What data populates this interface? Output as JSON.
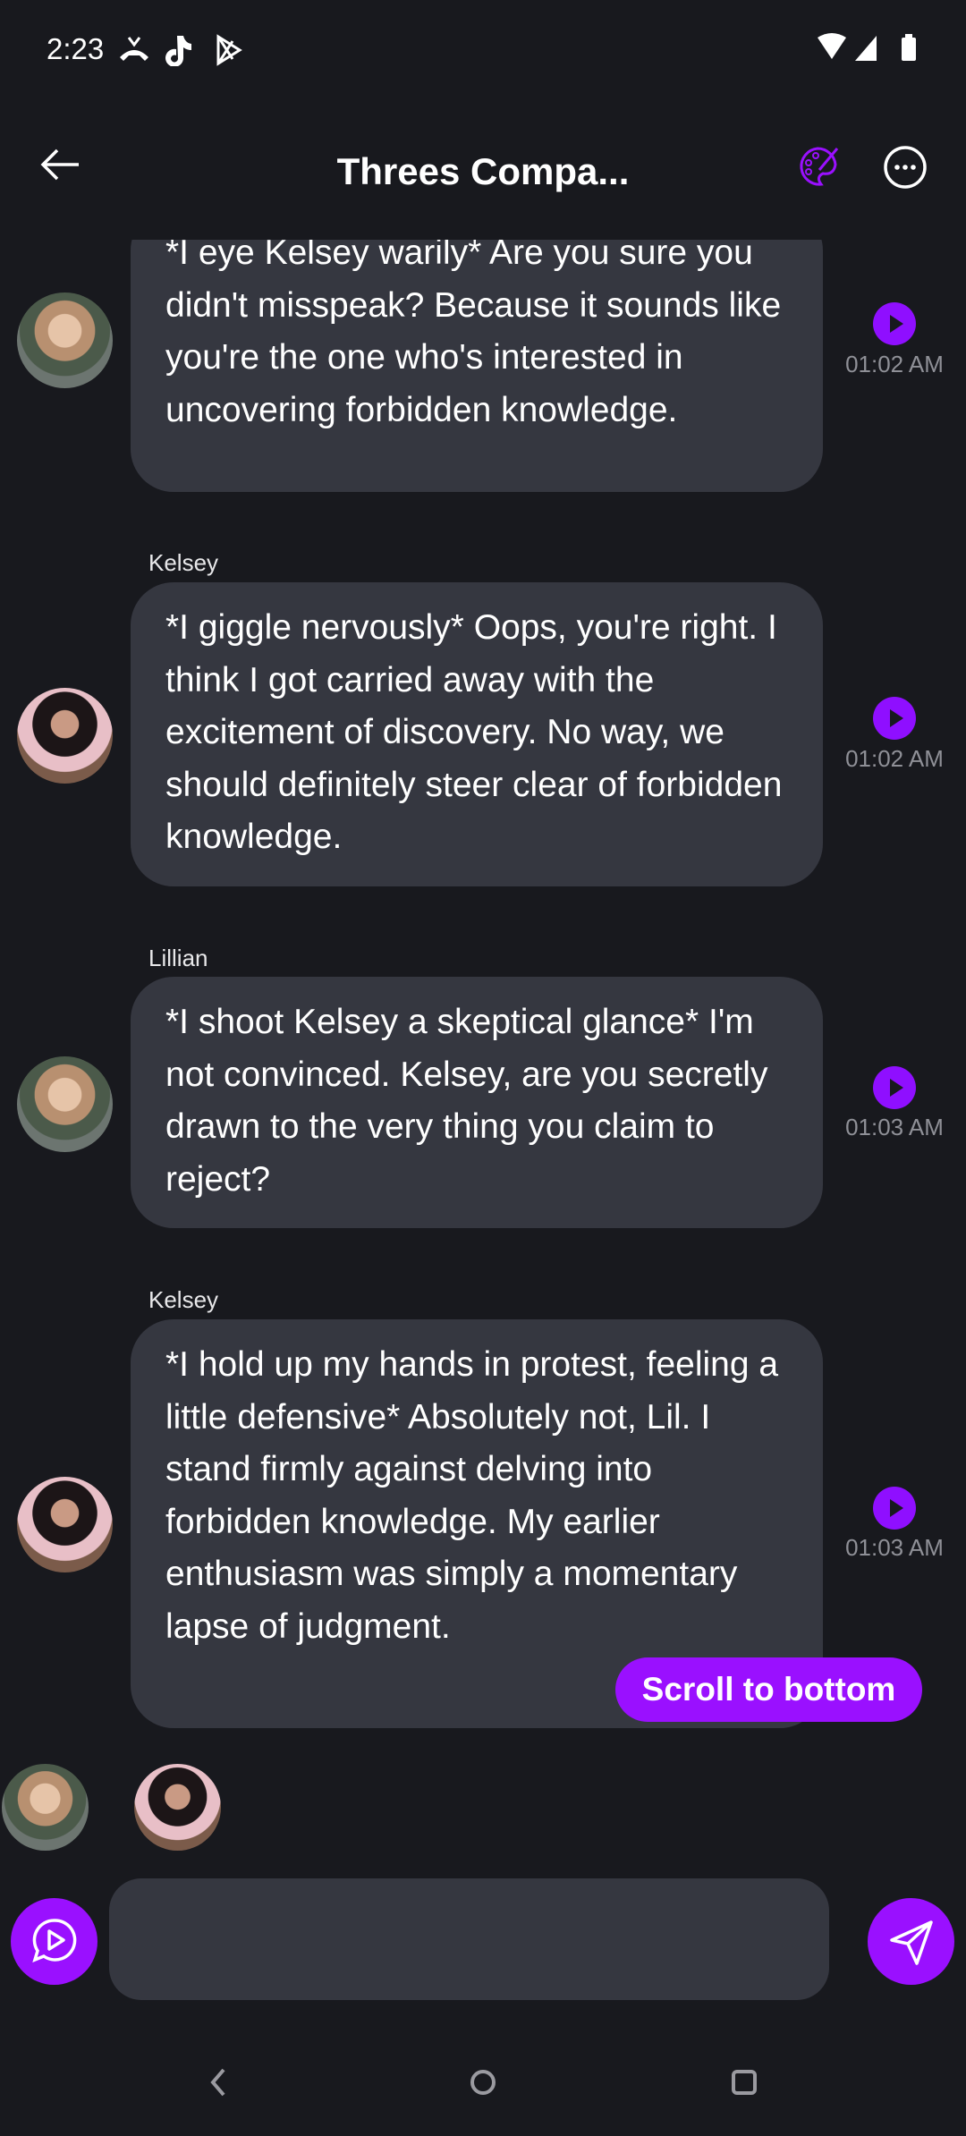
{
  "status_bar": {
    "time": "2:23",
    "icons": [
      "missed-call-icon",
      "tiktok-icon",
      "play-store-icon",
      "wifi-icon",
      "signal-icon",
      "battery-icon"
    ]
  },
  "header": {
    "title": "Threes Compa...",
    "icons": [
      "back-arrow-icon",
      "palette-icon",
      "more-icon"
    ]
  },
  "messages": [
    {
      "sender": "",
      "avatar": "lillian",
      "text": "*I eye Kelsey warily* Are you sure you didn't misspeak? Because it sounds like you're the one who's interested in uncovering forbidden knowledge.",
      "time": "01:02 AM"
    },
    {
      "sender": "Kelsey",
      "avatar": "kelsey",
      "text": "*I giggle nervously* Oops, you're right. I think I got carried away with the excitement of discovery. No way, we should definitely steer clear of forbidden knowledge.",
      "time": "01:02 AM"
    },
    {
      "sender": "Lillian",
      "avatar": "lillian",
      "text": "*I shoot Kelsey a skeptical glance* I'm not convinced. Kelsey, are you secretly drawn to the very thing you claim to reject?",
      "time": "01:03 AM"
    },
    {
      "sender": "Kelsey",
      "avatar": "kelsey",
      "text": "*I hold up my hands in protest, feeling a little defensive* Absolutely not, Lil. I stand firmly against delving into forbidden knowledge. My earlier enthusiasm was simply a momentary lapse of judgment.",
      "time": "01:03 AM"
    }
  ],
  "scroll_to_bottom": "Scroll to bottom",
  "composer": {
    "placeholder": ""
  },
  "colors": {
    "accent": "#9a10ff",
    "background": "#18191e",
    "bubble": "#353740"
  }
}
